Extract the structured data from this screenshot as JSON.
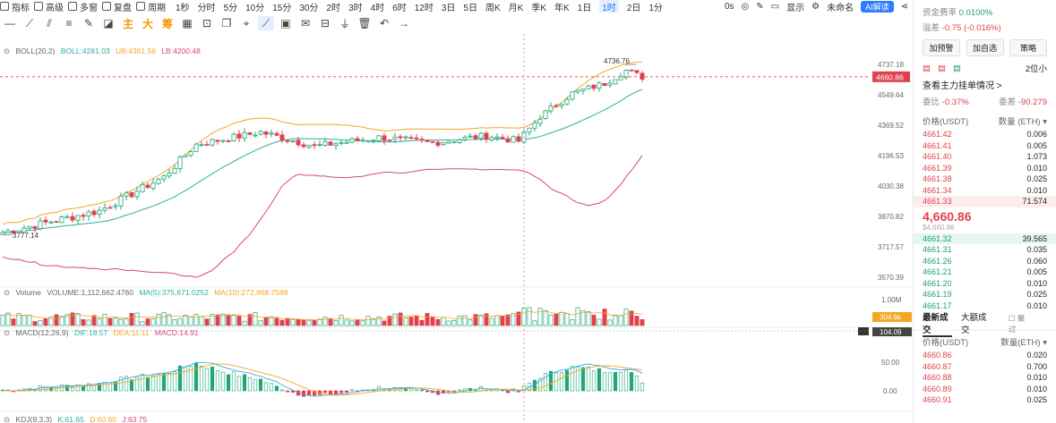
{
  "toolbar": {
    "indicators_label": "指标",
    "advanced_label": "高级",
    "multi_label": "多窗",
    "replay_label": "复盘",
    "cycle_label": "周期",
    "periods": [
      "1秒",
      "分时",
      "5分",
      "10分",
      "15分",
      "30分",
      "2时",
      "3时",
      "4时",
      "6时",
      "12时",
      "3日",
      "5日",
      "周K",
      "月K",
      "季K",
      "年K",
      "1日",
      "1时",
      "2日",
      "1分"
    ],
    "active_period": "1时",
    "right_items": [
      "0s",
      "显示",
      "未命名"
    ],
    "ai_label": "AI解读"
  },
  "drawing_tools": {
    "main": "主",
    "big": "大",
    "chips": "筹"
  },
  "boll": {
    "label": "BOLL(20,2)",
    "boll": "BOLL:4281.03",
    "ub": "UB:4361.59",
    "lb": "LB:4200.48"
  },
  "price_axis": [
    "4737.18",
    "4549.64",
    "4369.52",
    "4196.53",
    "4030.38",
    "3870.82",
    "3717.57",
    "3570.39"
  ],
  "current_price_tag": "4660.86",
  "high_marker": "4736.76",
  "low_marker": "3777.14",
  "volume": {
    "label": "Volume",
    "volume": "VOLUME:1,112,662.4760",
    "ma5": "MA(5):375,671.0252",
    "ma10": "MA(10):272,968.7599",
    "axis_top": "1.00M",
    "tag": "304.6k"
  },
  "macd": {
    "label": "MACD(12,26,9)",
    "dif": "DIF:18.57",
    "dea": "DEA:11.11",
    "macd": "MACD:14.91",
    "axis": [
      "104.09",
      "50.00",
      "0.00"
    ]
  },
  "kdj": {
    "label": "KDJ(9,3,3)",
    "k": "K:61.65",
    "d": "D:60.60",
    "j": "J:63.75"
  },
  "right_panel": {
    "stats": [
      {
        "label": "资金费率",
        "value": "0.0100%"
      },
      {
        "label": "溢差",
        "value": "-0.75 (-0.016%)"
      }
    ],
    "buttons": [
      "加预警",
      "加自选",
      "策略"
    ],
    "depth_select": "2位小",
    "main_orders_link": "查看主力挂单情况 >",
    "ratio_label_1": "委比",
    "ratio_1": "-0.37%",
    "ratio_label_2": "委差",
    "ratio_2": "-90.279",
    "ob_header": {
      "price": "价格(USDT)",
      "qty": "数量 (ETH) ▾"
    },
    "asks": [
      {
        "p": "4661.42",
        "q": "0.006"
      },
      {
        "p": "4661.41",
        "q": "0.005"
      },
      {
        "p": "4661.40",
        "q": "1.073"
      },
      {
        "p": "4661.39",
        "q": "0.010"
      },
      {
        "p": "4661.38",
        "q": "0.025"
      },
      {
        "p": "4661.34",
        "q": "0.010"
      },
      {
        "p": "4661.33",
        "q": "71.574"
      }
    ],
    "last_price": "4,660.86",
    "last_sub": "$4,660.86",
    "bids": [
      {
        "p": "4661.32",
        "q": "39.565"
      },
      {
        "p": "4661.31",
        "q": "0.035"
      },
      {
        "p": "4661.26",
        "q": "0.060"
      },
      {
        "p": "4661.21",
        "q": "0.005"
      },
      {
        "p": "4661.20",
        "q": "0.010"
      },
      {
        "p": "4661.19",
        "q": "0.025"
      },
      {
        "p": "4661.17",
        "q": "0.010"
      }
    ],
    "trade_tabs": [
      "最新成交",
      "大额成交"
    ],
    "aggregate_label": "聚过",
    "trades_header": {
      "price": "价格(USDT)",
      "qty": "数量(ETH) ▾"
    },
    "trades": [
      {
        "p": "4660.86",
        "q": "0.020"
      },
      {
        "p": "4660.87",
        "q": "0.700"
      },
      {
        "p": "4660.88",
        "q": "0.010"
      },
      {
        "p": "4660.89",
        "q": "0.010"
      },
      {
        "p": "4660.91",
        "q": "0.025"
      }
    ]
  },
  "colors": {
    "up": "#21a67a",
    "down": "#e0414c",
    "boll_mid": "#2ab0a0",
    "ub": "#f5a623",
    "lb": "#d6438a",
    "accent": "#1f6bff"
  }
}
